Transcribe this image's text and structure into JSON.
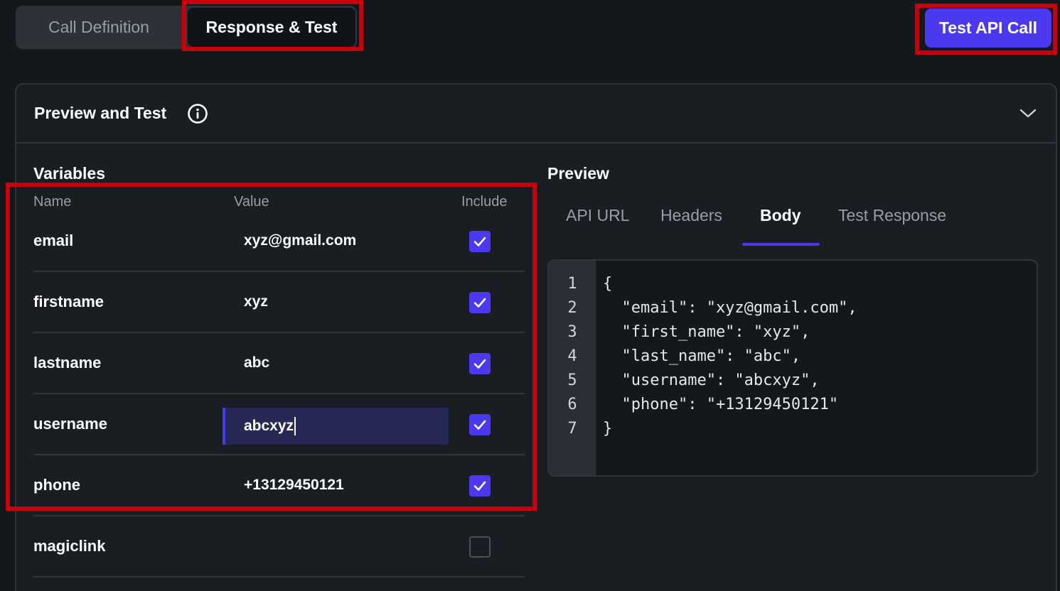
{
  "top_tabs": {
    "call_definition": "Call Definition",
    "response_test": "Response & Test"
  },
  "test_button": "Test API Call",
  "panel": {
    "title": "Preview and Test"
  },
  "variables": {
    "title": "Variables",
    "columns": {
      "name": "Name",
      "value": "Value",
      "include": "Include"
    },
    "rows": [
      {
        "name": "email",
        "value": "xyz@gmail.com",
        "include": true
      },
      {
        "name": "firstname",
        "value": "xyz",
        "include": true
      },
      {
        "name": "lastname",
        "value": "abc",
        "include": true
      },
      {
        "name": "username",
        "value": "abcxyz",
        "include": true
      },
      {
        "name": "phone",
        "value": "+13129450121",
        "include": true
      },
      {
        "name": "magiclink",
        "value": "",
        "include": false
      }
    ]
  },
  "preview": {
    "title": "Preview",
    "tabs": [
      "API URL",
      "Headers",
      "Body",
      "Test Response"
    ],
    "active_tab": "Body",
    "line_numbers": [
      "1",
      "2",
      "3",
      "4",
      "5",
      "6",
      "7"
    ],
    "code_lines": [
      "{",
      "  \"email\": \"xyz@gmail.com\",",
      "  \"first_name\": \"xyz\",",
      "  \"last_name\": \"abc\",",
      "  \"username\": \"abcxyz\",",
      "  \"phone\": \"+13129450121\"",
      "}"
    ]
  },
  "colors": {
    "accent": "#4b39ef",
    "highlight": "#c8000b",
    "background": "#14181b"
  }
}
